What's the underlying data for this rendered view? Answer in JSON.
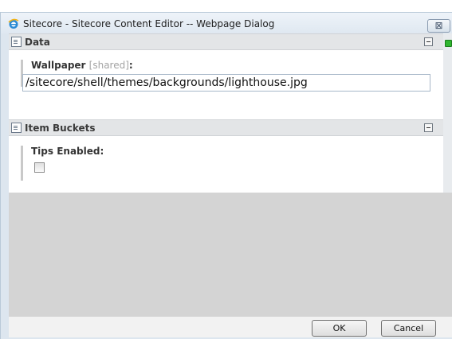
{
  "window": {
    "title": "Sitecore - Sitecore Content Editor -- Webpage Dialog",
    "close_glyph": "⊠"
  },
  "icons": {
    "title": "ie-icon",
    "section": "document-icon",
    "collapse": "minus-box-icon",
    "status": "green-status-icon"
  },
  "sections": {
    "data": {
      "title": "Data",
      "wallpaper_label": "Wallpaper",
      "wallpaper_shared": "[shared]",
      "wallpaper_colon": ":",
      "wallpaper_value": "/sitecore/shell/themes/backgrounds/lighthouse.jpg"
    },
    "buckets": {
      "title": "Item Buckets",
      "tips_label": "Tips Enabled:",
      "tips_checked": false
    }
  },
  "buttons": {
    "ok": "OK",
    "cancel": "Cancel"
  },
  "colors": {
    "status_green": "#2fb52f",
    "gray_area": "#d4d4d4"
  }
}
